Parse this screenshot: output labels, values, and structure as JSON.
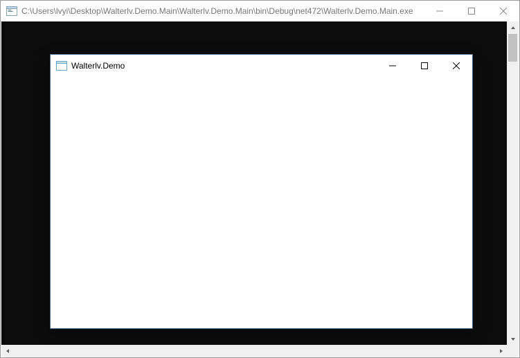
{
  "outer_window": {
    "title": "C:\\Users\\lvyi\\Desktop\\Walterlv.Demo.Main\\Walterlv.Demo.Main\\bin\\Debug\\net472\\Walterlv.Demo.Main.exe"
  },
  "inner_window": {
    "title": "Walterlv.Demo"
  }
}
